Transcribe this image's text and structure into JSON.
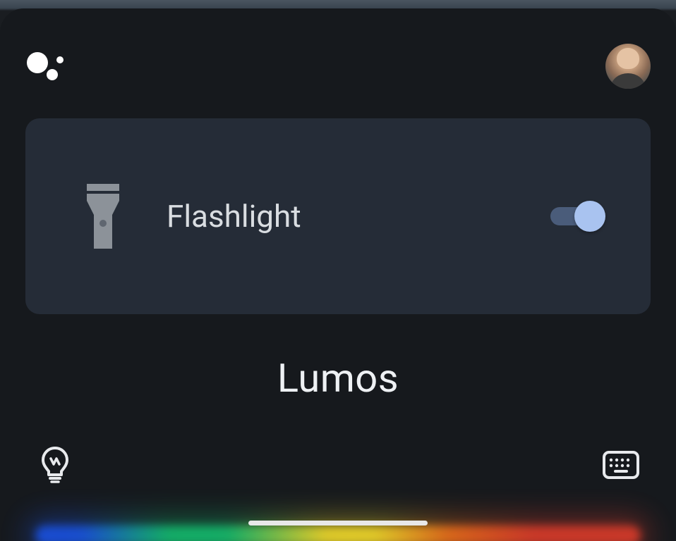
{
  "header": {
    "logo_name": "assistant-logo",
    "avatar_name": "user-avatar"
  },
  "card": {
    "icon_name": "flashlight-icon",
    "label": "Flashlight",
    "toggle_on": true
  },
  "voice_input": "Lumos",
  "bottom": {
    "left_icon_name": "lightbulb-icon",
    "right_icon_name": "keyboard-icon"
  },
  "colors": {
    "panel_bg": "#16191d",
    "card_bg": "#252c37",
    "text_primary": "#eef1f4",
    "text_secondary": "#d9dde1",
    "toggle_thumb": "#a9c3f0",
    "icon_muted": "#8c9299"
  }
}
